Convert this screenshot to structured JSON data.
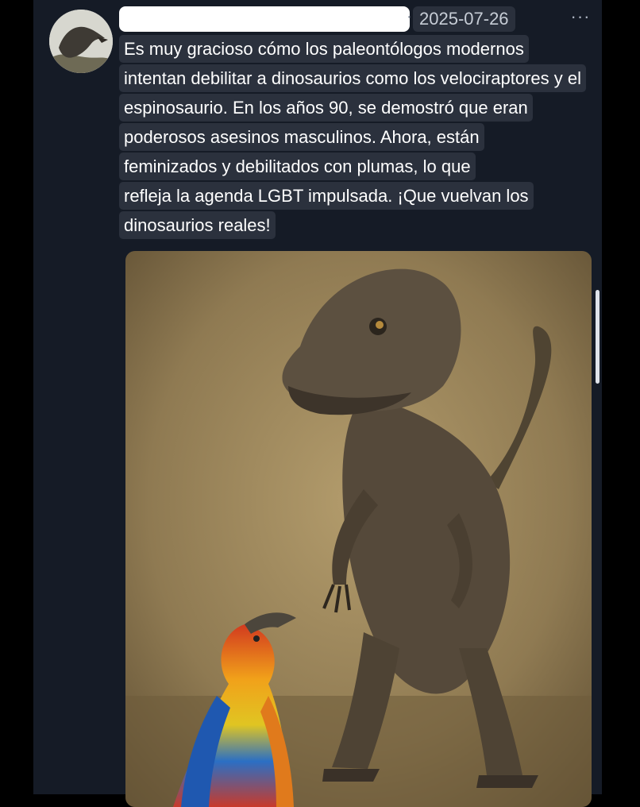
{
  "post": {
    "date": "2025-07-26",
    "separator": "·",
    "more_glyph": "···",
    "text_lines": [
      "Es muy gracioso cómo los paleontólogos modernos",
      "intentan debilitar a dinosaurios como los velociraptores y el",
      "espinosaurio. En los años 90, se demostró que eran",
      "poderosos asesinos masculinos. Ahora, están",
      "feminizados y debilitados con plumas, lo que",
      "refleja la agenda LGBT impulsada. ¡Que vuelvan los",
      "dinosaurios reales!"
    ]
  },
  "icons": {
    "more": "more-horizontal-icon"
  },
  "colors": {
    "panel_bg": "#151b26",
    "text_highlight": "#2b313d",
    "date_bg": "#2a303c",
    "text": "#ffffff",
    "date_text": "#c7cdd6"
  }
}
